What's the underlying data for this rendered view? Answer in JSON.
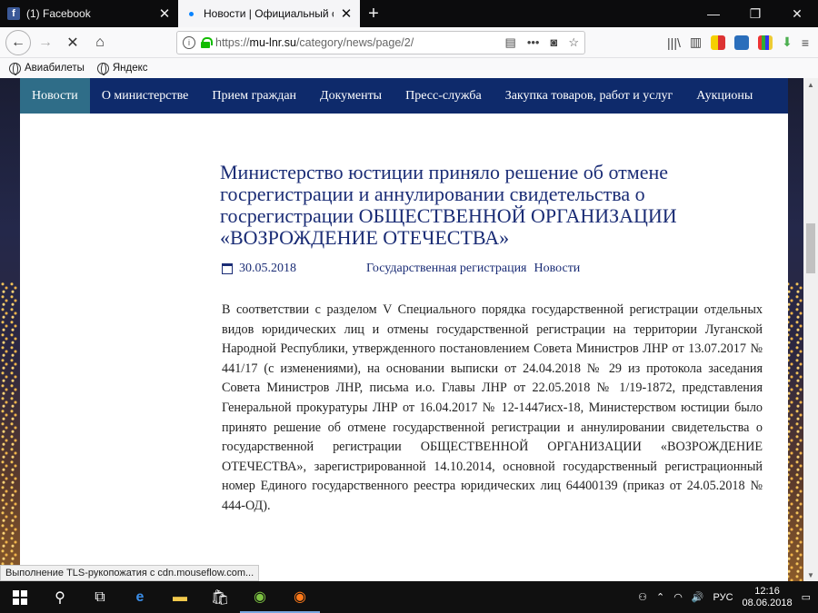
{
  "tabs": [
    {
      "title": "(1) Facebook",
      "icon": "facebook-icon"
    },
    {
      "title": "Новости | Официальный сайт",
      "icon": "loading-dot-icon"
    }
  ],
  "window": {
    "minimize": "—",
    "restore": "❐",
    "close": "✕"
  },
  "navbar": {
    "url_prefix": "https://",
    "url_host": "mu-lnr.su",
    "url_path": "/category/news/page/2/"
  },
  "bookmarks": [
    {
      "label": "Авиабилеты",
      "icon": "globe-icon"
    },
    {
      "label": "Яндекс",
      "icon": "globe-icon"
    }
  ],
  "menu": [
    {
      "label": "Новости",
      "active": true
    },
    {
      "label": "О министерстве"
    },
    {
      "label": "Прием граждан"
    },
    {
      "label": "Документы"
    },
    {
      "label": "Пресс-служба"
    },
    {
      "label": "Закупка товаров, работ и услуг"
    },
    {
      "label": "Аукционы"
    }
  ],
  "article": {
    "title": "Министерство юстиции приняло решение об отмене госрегистрации и аннулировании свидетельства о госрегистрации ОБЩЕСТВЕННОЙ ОРГАНИЗАЦИИ «ВОЗРОЖДЕНИЕ ОТЕЧЕСТВА»",
    "date": "30.05.2018",
    "categories": [
      "Государственная регистрация",
      "Новости"
    ],
    "body": "В соответствии с разделом V Специального порядка государственной регистрации отдельных видов юридических лиц и отмены государственной регистрации на территории Луганской Народной Республики, утвержденного постановлением Совета Министров ЛНР от 13.07.2017 № 441/17 (с изменениями), на основании выписки от 24.04.2018 № 29 из протокола заседания Совета Министров ЛНР, письма и.о. Главы ЛНР от 22.05.2018 № 1/19-1872, представления Генеральной прокуратуры ЛНР от 16.04.2017 № 12-1447исх-18, Министерством юстиции было принято решение об отмене государственной регистрации и аннулировании свидетельства о государственной регистрации ОБЩЕСТВЕННОЙ ОРГАНИЗАЦИИ «ВОЗРОЖДЕНИЕ ОТЕЧЕСТВА», зарегистрированной 14.10.2014, основной государственный регистрационный номер Единого государственного реестра юридических лиц 64400139 (приказ  от 24.05.2018 № 444-ОД)."
  },
  "status_text": "Выполнение TLS-рукопожатия с cdn.mouseflow.com...",
  "taskbar": {
    "lang": "РУС",
    "time": "12:16",
    "date": "08.06.2018"
  },
  "colors": {
    "menu_bg": "#0e2a6b",
    "menu_active": "#2f6d88",
    "title": "#1a2c75"
  }
}
